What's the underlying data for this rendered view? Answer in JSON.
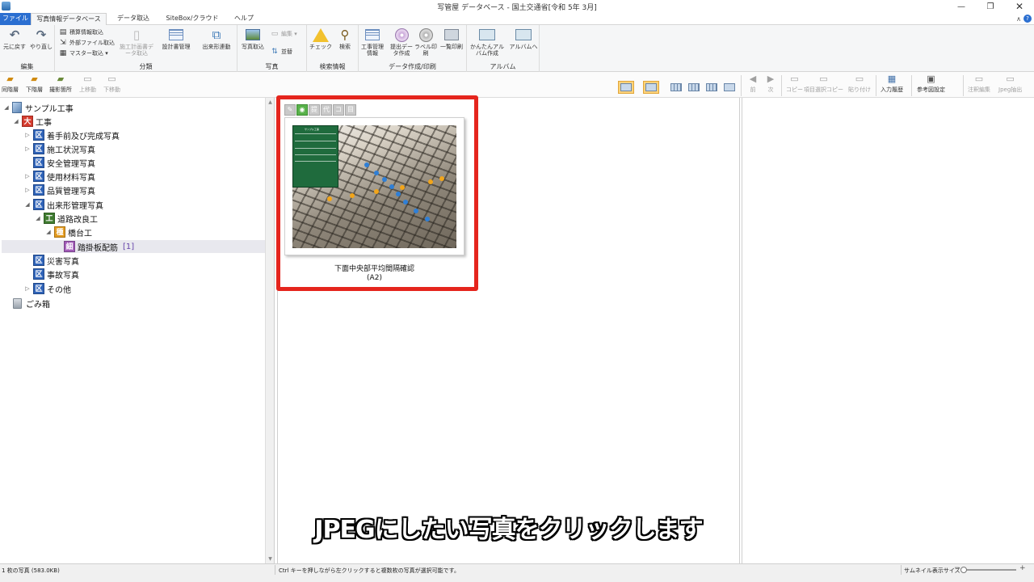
{
  "window": {
    "title": "写管屋 データベース - 国土交通省[令和 5年 3月]",
    "minimize": "—",
    "restore": "❐",
    "close": "✕"
  },
  "tabs": {
    "file": "ファイル",
    "photo_db": "写真情報データベース",
    "data_import": "データ取込",
    "sitebox": "SiteBox/クラウド",
    "help": "ヘルプ",
    "collapse": "∧",
    "help_icon": "?"
  },
  "ribbon": {
    "edit": {
      "title": "編集",
      "undo": "元に戻す",
      "redo": "やり直し"
    },
    "classify": {
      "title": "分類",
      "rows": [
        "積算情報取込",
        "外部ファイル取込",
        "マスター取込 ▾"
      ],
      "plan_import": "施工計画書データ取込",
      "design_mgmt": "設計書管理",
      "dekigata": "出来形連動"
    },
    "photo": {
      "title": "写真",
      "photo_import": "写真取込",
      "edit_row": "編集 ▾",
      "replace_row": "並替"
    },
    "search": {
      "title": "検索情報",
      "check": "チェック",
      "search": "検索"
    },
    "data": {
      "title": "データ作成/印刷",
      "work_info": "工事管理情報",
      "submit_data": "提出データ作成",
      "label_print": "ラベル印刷",
      "list_print": "一覧印刷"
    },
    "album": {
      "title": "アルバム",
      "easy_album": "かんたんアルバム作成",
      "to_album": "アルバムへ"
    }
  },
  "toolbar": {
    "same_level": "同階層",
    "lower_level": "下階層",
    "shoot_location": "撮影箇所",
    "move_up": "上移動",
    "move_down": "下移動",
    "prev": "前",
    "next": "次",
    "copy": "コピー",
    "item_copy": "項目選択コピー",
    "paste": "貼り付け",
    "input_history": "入力履歴",
    "ref_settings": "参考図設定",
    "note_edit": "注釈編集",
    "jpeg_extract": "Jpeg抽出"
  },
  "tree": {
    "root": "サンプル工事",
    "dai": "大",
    "ku": "区",
    "kou": "工",
    "shu": "種",
    "sai": "細",
    "work": "工事",
    "items": [
      "着手前及び完成写真",
      "施工状況写真",
      "安全管理写真",
      "使用材料写真",
      "品質管理写真",
      "出来形管理写真"
    ],
    "road": "道路改良工",
    "bridge": "橋台工",
    "selected": "踏掛板配筋",
    "selected_count": "[1]",
    "disaster": "災害写真",
    "accident": "事故写真",
    "other": "その他",
    "trash": "ごみ箱"
  },
  "thumbnail": {
    "caption": "下面中央部平均間隔確認",
    "code": "(A2)",
    "tools": [
      "✎",
      "◉",
      "提",
      "代",
      "コ",
      "目"
    ],
    "board_title": "サンプル工事"
  },
  "subtitle": "JPEGにしたい写真をクリックします",
  "status": {
    "count": "1 枚の写真 (583.0KB)",
    "hint": "Ctrl キーを押しながら左クリックすると複数枚の写真が選択可能です。",
    "thumb_size": "サムネイル表示サイズ",
    "zoom_out": "−",
    "zoom_in": "+"
  },
  "colors": {
    "highlight": "#e5251d",
    "file_tab": "#2b6fd1",
    "selected_view": "#ffd27a"
  }
}
